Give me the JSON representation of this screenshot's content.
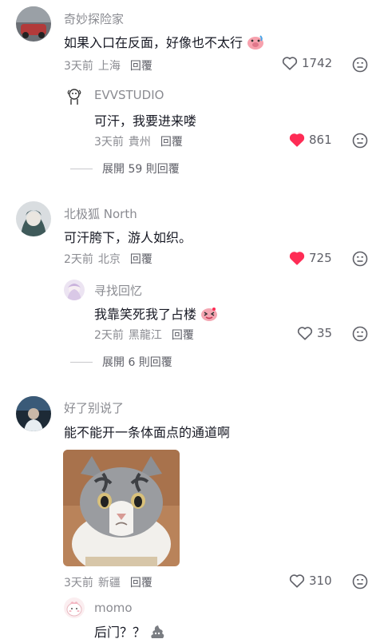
{
  "comments": [
    {
      "username": "奇妙探险家",
      "text": "如果入口在反面，好像也不太行",
      "time": "3天前",
      "location": "上海",
      "reply_label": "回覆",
      "likes": "1742",
      "liked": false,
      "replies": [
        {
          "username": "EVVSTUDIO",
          "text": "可汗，我要进来喽",
          "time": "3天前",
          "location": "貴州",
          "reply_label": "回覆",
          "likes": "861",
          "liked": true
        }
      ],
      "expand_label": "展開 59 則回覆"
    },
    {
      "username": "北极狐 North",
      "text": "可汗胯下，游人如织。",
      "time": "2天前",
      "location": "北京",
      "reply_label": "回覆",
      "likes": "725",
      "liked": true,
      "replies": [
        {
          "username": "寻找回忆",
          "text": "我靠笑死我了占楼",
          "time": "2天前",
          "location": "黑龍江",
          "reply_label": "回覆",
          "likes": "35",
          "liked": false
        }
      ],
      "expand_label": "展開 6 則回覆"
    },
    {
      "username": "好了别说了",
      "text": "能不能开一条体面点的通道啊",
      "time": "3天前",
      "location": "新疆",
      "reply_label": "回覆",
      "likes": "310",
      "liked": false,
      "replies": [
        {
          "username": "momo",
          "text": "后门？？"
        }
      ]
    }
  ],
  "colors": {
    "liked_heart": "#fe2c55",
    "secondary_text": "#8a8b91"
  }
}
